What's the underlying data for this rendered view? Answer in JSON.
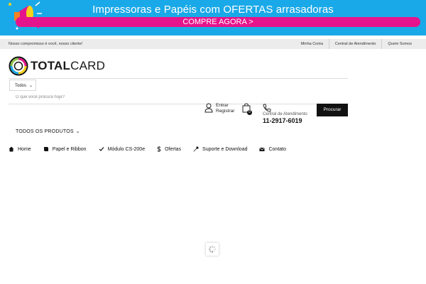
{
  "promo": {
    "title": "Impressoras e Papéis com OFERTAS arrasadoras",
    "cta": "COMPRE AGORA >"
  },
  "topbar": {
    "tagline": "Nosso compromisso é você, nosso cliente!",
    "links": [
      "Minha Conta",
      "Central de Atendimento",
      "Quem Somos"
    ]
  },
  "logo": {
    "bold": "TOTAL",
    "light": "CARD"
  },
  "search": {
    "category": "Todos",
    "placeholder": "O que você procura hoje?",
    "button": "Procurar"
  },
  "account": {
    "login": "Entrar",
    "register": "Registrar"
  },
  "cart": {
    "count": "0"
  },
  "support": {
    "label": "Central de Atendimento",
    "phone": "11-2917-6019"
  },
  "menu": {
    "all_products": "TODOS OS PRODUTOS"
  },
  "nav": [
    {
      "label": "Home",
      "icon": "home-icon"
    },
    {
      "label": "Papel e Ribbon",
      "icon": "book-icon"
    },
    {
      "label": "Módulo CS-200e",
      "icon": "check-icon"
    },
    {
      "label": "Ofertas",
      "icon": "dollar-icon"
    },
    {
      "label": "Suporte e Download",
      "icon": "wrench-icon"
    },
    {
      "label": "Contato",
      "icon": "envelope-icon"
    }
  ],
  "colors": {
    "promo_bg": "#1aa9e8",
    "cta_bg": "#e5148c",
    "button_bg": "#111111",
    "topbar_bg": "#ececec"
  }
}
